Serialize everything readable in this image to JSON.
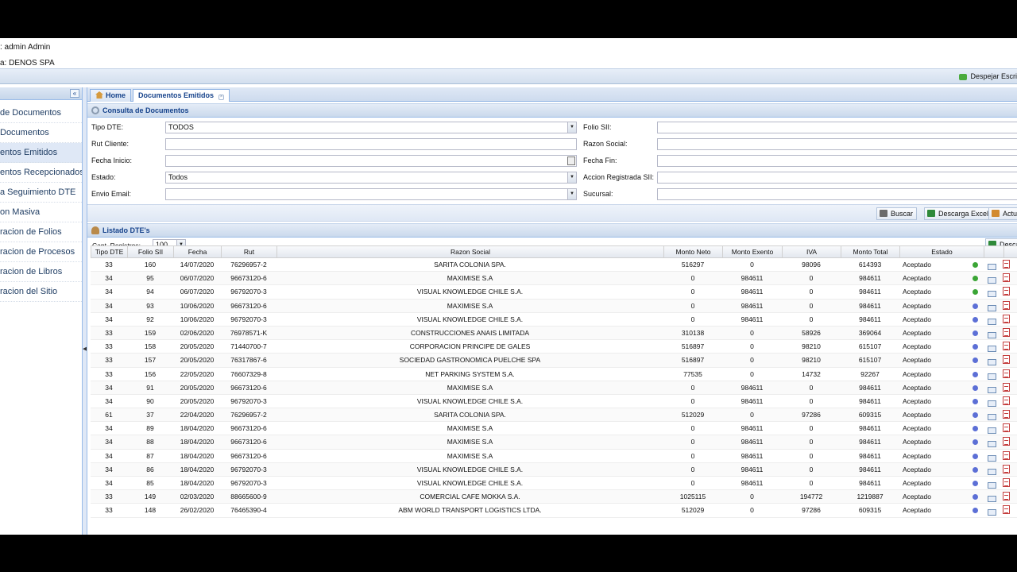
{
  "header": {
    "user_line": ": admin Admin",
    "company_line": "a: DENOS SPA",
    "clear_desk_label": "Despejar Escri"
  },
  "sidebar": {
    "collapse_icon": "double-chevron-left-icon",
    "items": [
      {
        "label": " de Documentos"
      },
      {
        "label": " Documentos"
      },
      {
        "label": "entos Emitidos"
      },
      {
        "label": "entos Recepcionados"
      },
      {
        "label": " a Seguimiento DTE"
      },
      {
        "label": "on Masiva"
      },
      {
        "label": "racion de Folios"
      },
      {
        "label": "racion de Procesos"
      },
      {
        "label": "racion de Libros"
      },
      {
        "label": "racion del Sitio"
      }
    ]
  },
  "tabs": [
    {
      "label": "Home"
    },
    {
      "label": "Documentos Emitidos"
    }
  ],
  "query_panel": {
    "title": "Consulta de Documentos",
    "fields": {
      "tipo_dte": {
        "label": "Tipo DTE:",
        "value": "TODOS"
      },
      "rut_cliente": {
        "label": "Rut Cliente:",
        "value": ""
      },
      "fecha_inicio": {
        "label": "Fecha Inicio:",
        "value": ""
      },
      "estado": {
        "label": "Estado:",
        "value": "Todos"
      },
      "envio_email": {
        "label": "Envio Email:",
        "value": ""
      },
      "folio_sii": {
        "label": "Folio SII:",
        "value": ""
      },
      "razon_social": {
        "label": "Razon Social:",
        "value": ""
      },
      "fecha_fin": {
        "label": "Fecha Fin:",
        "value": ""
      },
      "accion_sii": {
        "label": "Accion Registrada SII:",
        "value": ""
      },
      "sucursal": {
        "label": "Sucursal:",
        "value": ""
      }
    },
    "buttons": {
      "buscar": "Buscar",
      "descarga_excel": "Descarga Excel",
      "actualizar": "Actu"
    }
  },
  "list_panel": {
    "title": "Listado DTE's",
    "cant_registros_label": "Cant. Registros:",
    "cant_registros_value": "100",
    "descarga_label": "Desca",
    "columns": [
      "Tipo DTE",
      "Folio SII",
      "Fecha",
      "Rut",
      "Razon Social",
      "Monto Neto",
      "Monto Exento",
      "IVA",
      "Monto Total",
      "Estado"
    ],
    "status_colors": {
      "green": "#3aa535",
      "blue": "#5c6fd6"
    },
    "rows": [
      {
        "tipo": "33",
        "folio": "160",
        "fecha": "14/07/2020",
        "rut": "76296957-2",
        "razon": "SARITA COLONIA SPA.",
        "neto": "516297",
        "exento": "0",
        "iva": "98096",
        "total": "614393",
        "estado": "Aceptado",
        "dot": "green"
      },
      {
        "tipo": "34",
        "folio": "95",
        "fecha": "06/07/2020",
        "rut": "96673120-6",
        "razon": "MAXIMISE S.A",
        "neto": "0",
        "exento": "984611",
        "iva": "0",
        "total": "984611",
        "estado": "Aceptado",
        "dot": "green"
      },
      {
        "tipo": "34",
        "folio": "94",
        "fecha": "06/07/2020",
        "rut": "96792070-3",
        "razon": "VISUAL KNOWLEDGE CHILE S.A.",
        "neto": "0",
        "exento": "984611",
        "iva": "0",
        "total": "984611",
        "estado": "Aceptado",
        "dot": "green"
      },
      {
        "tipo": "34",
        "folio": "93",
        "fecha": "10/06/2020",
        "rut": "96673120-6",
        "razon": "MAXIMISE S.A",
        "neto": "0",
        "exento": "984611",
        "iva": "0",
        "total": "984611",
        "estado": "Aceptado",
        "dot": "blue"
      },
      {
        "tipo": "34",
        "folio": "92",
        "fecha": "10/06/2020",
        "rut": "96792070-3",
        "razon": "VISUAL KNOWLEDGE CHILE S.A.",
        "neto": "0",
        "exento": "984611",
        "iva": "0",
        "total": "984611",
        "estado": "Aceptado",
        "dot": "blue"
      },
      {
        "tipo": "33",
        "folio": "159",
        "fecha": "02/06/2020",
        "rut": "76978571-K",
        "razon": "CONSTRUCCIONES ANAIS LIMITADA",
        "neto": "310138",
        "exento": "0",
        "iva": "58926",
        "total": "369064",
        "estado": "Aceptado",
        "dot": "blue"
      },
      {
        "tipo": "33",
        "folio": "158",
        "fecha": "20/05/2020",
        "rut": "71440700-7",
        "razon": "CORPORACION PRINCIPE DE GALES",
        "neto": "516897",
        "exento": "0",
        "iva": "98210",
        "total": "615107",
        "estado": "Aceptado",
        "dot": "blue"
      },
      {
        "tipo": "33",
        "folio": "157",
        "fecha": "20/05/2020",
        "rut": "76317867-6",
        "razon": "SOCIEDAD GASTRONOMICA PUELCHE SPA",
        "neto": "516897",
        "exento": "0",
        "iva": "98210",
        "total": "615107",
        "estado": "Aceptado",
        "dot": "blue"
      },
      {
        "tipo": "33",
        "folio": "156",
        "fecha": "22/05/2020",
        "rut": "76607329-8",
        "razon": "NET PARKING SYSTEM S.A.",
        "neto": "77535",
        "exento": "0",
        "iva": "14732",
        "total": "92267",
        "estado": "Aceptado",
        "dot": "blue"
      },
      {
        "tipo": "34",
        "folio": "91",
        "fecha": "20/05/2020",
        "rut": "96673120-6",
        "razon": "MAXIMISE S.A",
        "neto": "0",
        "exento": "984611",
        "iva": "0",
        "total": "984611",
        "estado": "Aceptado",
        "dot": "blue"
      },
      {
        "tipo": "34",
        "folio": "90",
        "fecha": "20/05/2020",
        "rut": "96792070-3",
        "razon": "VISUAL KNOWLEDGE CHILE S.A.",
        "neto": "0",
        "exento": "984611",
        "iva": "0",
        "total": "984611",
        "estado": "Aceptado",
        "dot": "blue"
      },
      {
        "tipo": "61",
        "folio": "37",
        "fecha": "22/04/2020",
        "rut": "76296957-2",
        "razon": "SARITA COLONIA SPA.",
        "neto": "512029",
        "exento": "0",
        "iva": "97286",
        "total": "609315",
        "estado": "Aceptado",
        "dot": "blue"
      },
      {
        "tipo": "34",
        "folio": "89",
        "fecha": "18/04/2020",
        "rut": "96673120-6",
        "razon": "MAXIMISE S.A",
        "neto": "0",
        "exento": "984611",
        "iva": "0",
        "total": "984611",
        "estado": "Aceptado",
        "dot": "blue"
      },
      {
        "tipo": "34",
        "folio": "88",
        "fecha": "18/04/2020",
        "rut": "96673120-6",
        "razon": "MAXIMISE S.A",
        "neto": "0",
        "exento": "984611",
        "iva": "0",
        "total": "984611",
        "estado": "Aceptado",
        "dot": "blue"
      },
      {
        "tipo": "34",
        "folio": "87",
        "fecha": "18/04/2020",
        "rut": "96673120-6",
        "razon": "MAXIMISE S.A",
        "neto": "0",
        "exento": "984611",
        "iva": "0",
        "total": "984611",
        "estado": "Aceptado",
        "dot": "blue"
      },
      {
        "tipo": "34",
        "folio": "86",
        "fecha": "18/04/2020",
        "rut": "96792070-3",
        "razon": "VISUAL KNOWLEDGE CHILE S.A.",
        "neto": "0",
        "exento": "984611",
        "iva": "0",
        "total": "984611",
        "estado": "Aceptado",
        "dot": "blue"
      },
      {
        "tipo": "34",
        "folio": "85",
        "fecha": "18/04/2020",
        "rut": "96792070-3",
        "razon": "VISUAL KNOWLEDGE CHILE S.A.",
        "neto": "0",
        "exento": "984611",
        "iva": "0",
        "total": "984611",
        "estado": "Aceptado",
        "dot": "blue"
      },
      {
        "tipo": "33",
        "folio": "149",
        "fecha": "02/03/2020",
        "rut": "88665600-9",
        "razon": "COMERCIAL CAFE MOKKA S.A.",
        "neto": "1025115",
        "exento": "0",
        "iva": "194772",
        "total": "1219887",
        "estado": "Aceptado",
        "dot": "blue"
      },
      {
        "tipo": "33",
        "folio": "148",
        "fecha": "26/02/2020",
        "rut": "76465390-4",
        "razon": "ABM WORLD TRANSPORT LOGISTICS LTDA.",
        "neto": "512029",
        "exento": "0",
        "iva": "97286",
        "total": "609315",
        "estado": "Aceptado",
        "dot": "blue"
      }
    ]
  }
}
